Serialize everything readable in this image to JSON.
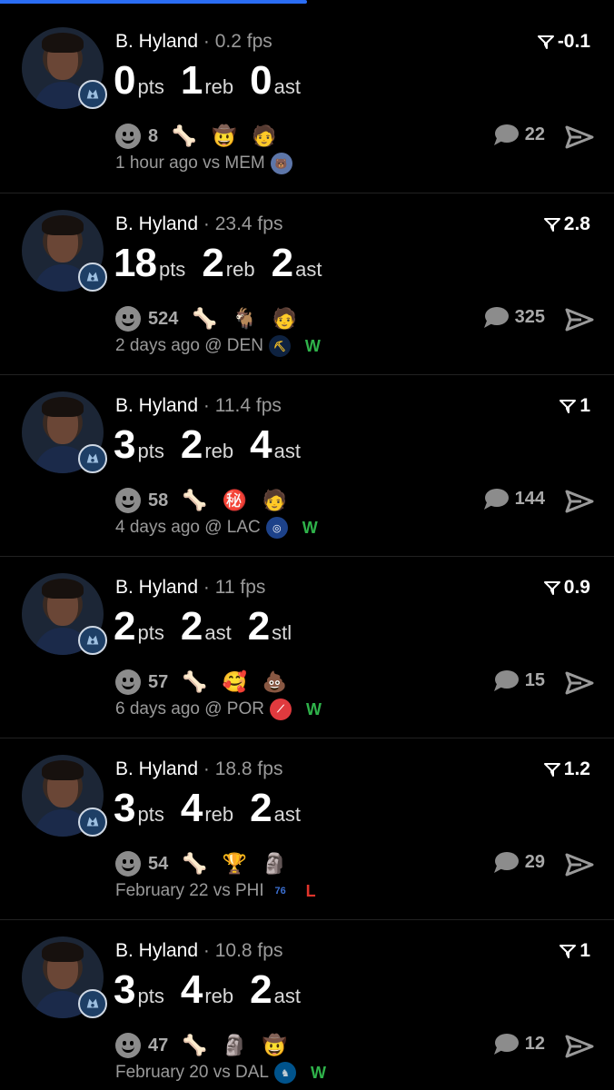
{
  "colors": {
    "win": "#2fb24a",
    "loss": "#e0342b",
    "accent": "#2a6df4"
  },
  "cards": [
    {
      "name": "B. Hyland",
      "fps": "0.2 fps",
      "score": "-0.1",
      "stats": [
        {
          "num": "0",
          "lab": "pts"
        },
        {
          "num": "1",
          "lab": "reb"
        },
        {
          "num": "0",
          "lab": "ast"
        }
      ],
      "likes": "8",
      "emojis": [
        "🦴",
        "🤠",
        "🧑"
      ],
      "comments": "22",
      "meta": "1 hour ago vs MEM",
      "opp_logo": "grizzlies-logo",
      "result": ""
    },
    {
      "name": "B. Hyland",
      "fps": "23.4 fps",
      "score": "2.8",
      "stats": [
        {
          "num": "18",
          "lab": "pts"
        },
        {
          "num": "2",
          "lab": "reb"
        },
        {
          "num": "2",
          "lab": "ast"
        }
      ],
      "likes": "524",
      "emojis": [
        "🦴",
        "🐐",
        "🧑"
      ],
      "comments": "325",
      "meta": "2 days ago @ DEN",
      "opp_logo": "nuggets-logo",
      "result": "W"
    },
    {
      "name": "B. Hyland",
      "fps": "11.4 fps",
      "score": "1",
      "stats": [
        {
          "num": "3",
          "lab": "pts"
        },
        {
          "num": "2",
          "lab": "reb"
        },
        {
          "num": "4",
          "lab": "ast"
        }
      ],
      "likes": "58",
      "emojis": [
        "🦴",
        "㊙️",
        "🧑"
      ],
      "comments": "144",
      "meta": "4 days ago @ LAC",
      "opp_logo": "clippers-logo",
      "result": "W"
    },
    {
      "name": "B. Hyland",
      "fps": "11 fps",
      "score": "0.9",
      "stats": [
        {
          "num": "2",
          "lab": "pts"
        },
        {
          "num": "2",
          "lab": "ast"
        },
        {
          "num": "2",
          "lab": "stl"
        }
      ],
      "likes": "57",
      "emojis": [
        "🦴",
        "🥰",
        "💩"
      ],
      "comments": "15",
      "meta": "6 days ago @ POR",
      "opp_logo": "blazers-logo",
      "result": "W"
    },
    {
      "name": "B. Hyland",
      "fps": "18.8 fps",
      "score": "1.2",
      "stats": [
        {
          "num": "3",
          "lab": "pts"
        },
        {
          "num": "4",
          "lab": "reb"
        },
        {
          "num": "2",
          "lab": "ast"
        }
      ],
      "likes": "54",
      "emojis": [
        "🦴",
        "🏆",
        "🗿"
      ],
      "comments": "29",
      "meta": "February 22 vs PHI",
      "opp_logo": "76ers-logo",
      "result": "L"
    },
    {
      "name": "B. Hyland",
      "fps": "10.8 fps",
      "score": "1",
      "stats": [
        {
          "num": "3",
          "lab": "pts"
        },
        {
          "num": "4",
          "lab": "reb"
        },
        {
          "num": "2",
          "lab": "ast"
        }
      ],
      "likes": "47",
      "emojis": [
        "🦴",
        "🗿",
        "🤠"
      ],
      "comments": "12",
      "meta": "February 20 vs DAL",
      "opp_logo": "mavericks-logo",
      "result": "W"
    }
  ]
}
